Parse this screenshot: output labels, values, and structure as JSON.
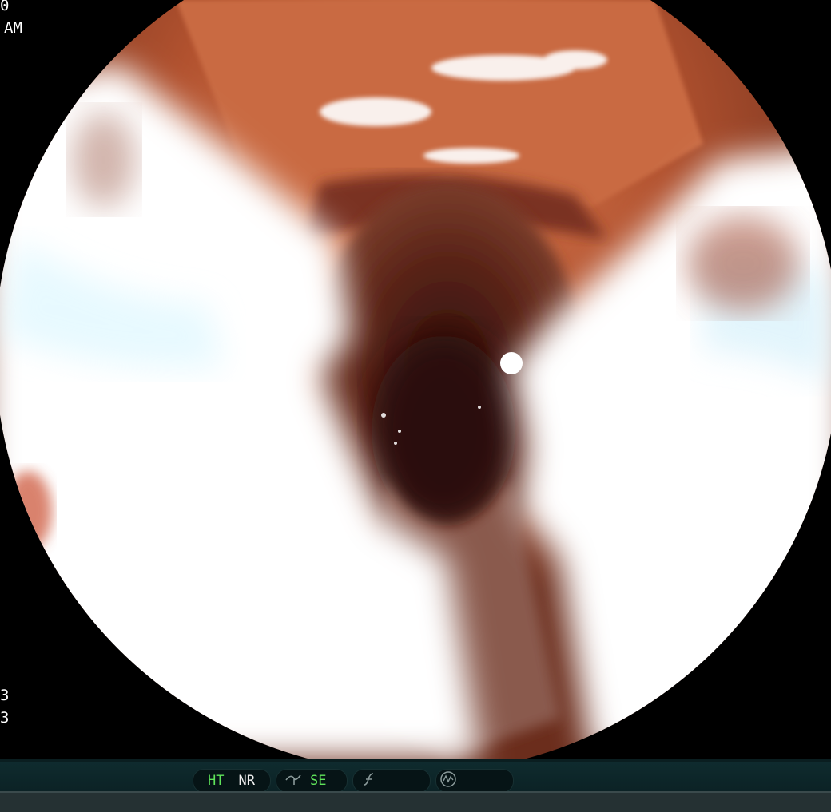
{
  "overlay": {
    "top_left_line1": "0",
    "top_left_line2": "AM",
    "bottom_left_line1": "3",
    "bottom_left_line2": "3"
  },
  "status_bar": {
    "ht": "HT",
    "nr": "NR",
    "se": "SE",
    "ht_color": "#5fe35a",
    "se_color": "#5fe35a",
    "nr_color": "#f0f0f0",
    "icons": [
      "enhance-curve-icon",
      "function-f-icon",
      "waveform-circle-icon"
    ]
  }
}
